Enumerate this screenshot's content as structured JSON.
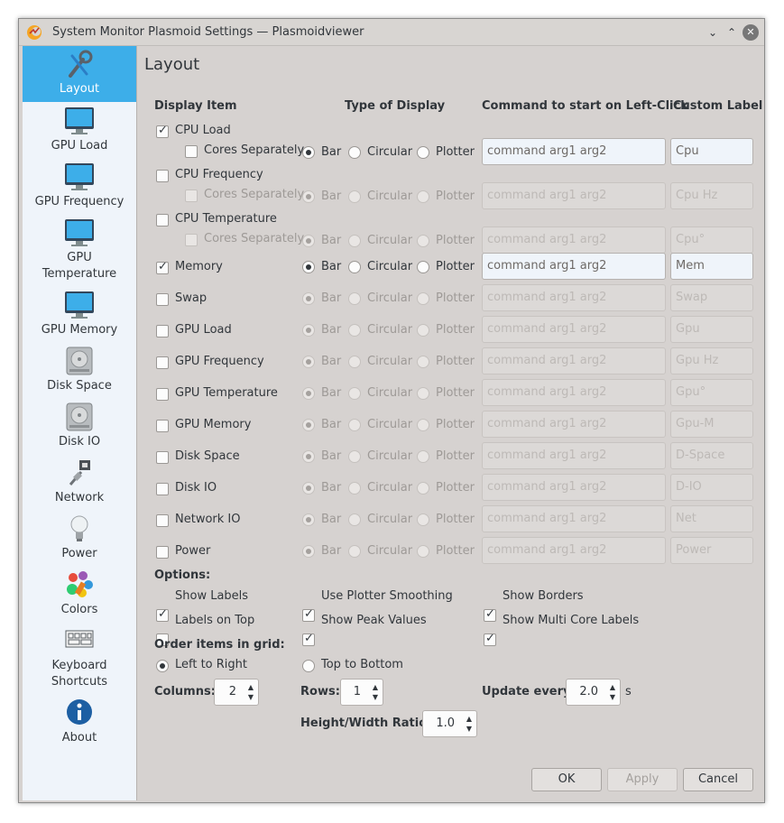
{
  "window": {
    "title": "System Monitor Plasmoid Settings — Plasmoidviewer",
    "controls": {
      "minimize": "⌄",
      "maximize": "⌃",
      "close": "✕"
    }
  },
  "sidebar": {
    "items": [
      {
        "label": "Layout",
        "icon": "wrench-screwdriver-icon",
        "selected": true
      },
      {
        "label": "GPU Load",
        "icon": "monitor-icon"
      },
      {
        "label": "GPU Frequency",
        "icon": "monitor-icon"
      },
      {
        "label": "GPU Temperature",
        "line1": "GPU",
        "line2": "Temperature",
        "icon": "monitor-icon"
      },
      {
        "label": "GPU Memory",
        "icon": "monitor-icon"
      },
      {
        "label": "Disk Space",
        "icon": "hard-disk-icon"
      },
      {
        "label": "Disk IO",
        "icon": "hard-disk-icon"
      },
      {
        "label": "Network",
        "icon": "network-plug-icon"
      },
      {
        "label": "Power",
        "icon": "lightbulb-icon"
      },
      {
        "label": "Colors",
        "icon": "color-palette-icon"
      },
      {
        "label": "Keyboard Shortcuts",
        "line1": "Keyboard",
        "line2": "Shortcuts",
        "icon": "keyboard-icon"
      },
      {
        "label": "About",
        "icon": "info-icon"
      }
    ]
  },
  "page": {
    "title": "Layout",
    "headers": {
      "display_item": "Display Item",
      "type_of_display": "Type of Display",
      "command": "Command to start on Left-Click",
      "custom_label": "Custom Label"
    },
    "types": {
      "bar": "Bar",
      "circular": "Circular",
      "plotter": "Plotter"
    },
    "cores_separately": "Cores Separately",
    "command_placeholder": "command arg1 arg2",
    "rows": [
      {
        "label": "CPU Load",
        "checked": true,
        "custom": "Cpu",
        "command": "command arg1 arg2",
        "enabled": true
      },
      {
        "label": "CPU Frequency",
        "checked": false,
        "custom": "Cpu Hz",
        "command": "",
        "enabled": false
      },
      {
        "label": "CPU Temperature",
        "checked": false,
        "custom": "Cpu°",
        "command": "",
        "enabled": false
      },
      {
        "label": "Memory",
        "checked": true,
        "custom": "Mem",
        "command": "command arg1 arg2",
        "enabled": true
      },
      {
        "label": "Swap",
        "checked": false,
        "custom": "Swap",
        "command": "",
        "enabled": false
      },
      {
        "label": "GPU Load",
        "checked": false,
        "custom": "Gpu",
        "command": "",
        "enabled": false
      },
      {
        "label": "GPU Frequency",
        "checked": false,
        "custom": "Gpu Hz",
        "command": "",
        "enabled": false
      },
      {
        "label": "GPU Temperature",
        "checked": false,
        "custom": "Gpu°",
        "command": "",
        "enabled": false
      },
      {
        "label": "GPU Memory",
        "checked": false,
        "custom": "Gpu-M",
        "command": "",
        "enabled": false
      },
      {
        "label": "Disk Space",
        "checked": false,
        "custom": "D-Space",
        "command": "",
        "enabled": false
      },
      {
        "label": "Disk IO",
        "checked": false,
        "custom": "D-IO",
        "command": "",
        "enabled": false
      },
      {
        "label": "Network IO",
        "checked": false,
        "custom": "Net",
        "command": "",
        "enabled": false
      },
      {
        "label": "Power",
        "checked": false,
        "custom": "Power",
        "command": "",
        "enabled": false
      }
    ],
    "options": {
      "title": "Options:",
      "show_labels": "Show Labels",
      "use_plotter_smoothing": "Use Plotter Smoothing",
      "show_borders": "Show Borders",
      "labels_on_top": "Labels on Top",
      "show_peak_values": "Show Peak Values",
      "show_multi_core_labels": "Show Multi Core Labels"
    },
    "order": {
      "title": "Order items in grid:",
      "left_to_right": "Left to Right",
      "top_to_bottom": "Top to Bottom"
    },
    "columns": {
      "label": "Columns:",
      "value": "2"
    },
    "rows_spin": {
      "label": "Rows:",
      "value": "1"
    },
    "update": {
      "label": "Update every",
      "value": "2.0",
      "unit": "s"
    },
    "ratio": {
      "label": "Height/Width Ratio:",
      "value": "1.0"
    },
    "buttons": {
      "ok": "OK",
      "apply": "Apply",
      "cancel": "Cancel"
    }
  }
}
